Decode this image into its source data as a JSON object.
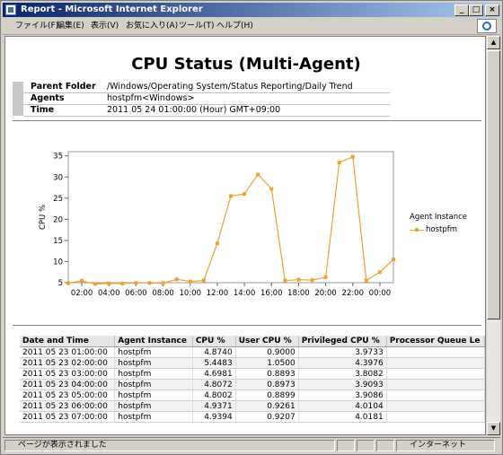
{
  "window": {
    "title": "Report - Microsoft Internet Explorer",
    "status_text": "ページが表示されました",
    "zone_text": "インターネット"
  },
  "menu": [
    "ファイル(F)",
    "編集(E)",
    "表示(V)",
    "お気に入り(A)",
    "ツール(T)",
    "ヘルプ(H)"
  ],
  "report": {
    "title": "CPU Status (Multi-Agent)",
    "info": [
      {
        "key": "Parent Folder",
        "value": "/Windows/Operating System/Status Reporting/Daily Trend"
      },
      {
        "key": "Agents",
        "value": "hostpfm<Windows>"
      },
      {
        "key": "Time",
        "value": "2011 05 24 01:00:00  (Hour)  GMT+09:00"
      }
    ]
  },
  "chart_data": {
    "type": "line",
    "ylabel": "CPU %",
    "xlabel": "",
    "ylim": [
      5,
      36
    ],
    "yticks": [
      5,
      10,
      15,
      20,
      25,
      30,
      35
    ],
    "xtick_labels": [
      "02:00",
      "04:00",
      "06:00",
      "08:00",
      "10:00",
      "12:00",
      "14:00",
      "16:00",
      "18:00",
      "20:00",
      "22:00",
      "00:00"
    ],
    "legend_title": "Agent Instance",
    "color": "#f0a030",
    "series": [
      {
        "name": "hostpfm",
        "x": [
          "01:00",
          "02:00",
          "03:00",
          "04:00",
          "05:00",
          "06:00",
          "07:00",
          "08:00",
          "09:00",
          "10:00",
          "11:00",
          "12:00",
          "13:00",
          "14:00",
          "15:00",
          "16:00",
          "17:00",
          "18:00",
          "19:00",
          "20:00",
          "21:00",
          "22:00",
          "23:00",
          "00:00",
          "01:00"
        ],
        "values": [
          4.874,
          5.448,
          4.698,
          4.807,
          4.8,
          4.937,
          4.939,
          4.9,
          5.8,
          5.3,
          5.5,
          14.3,
          25.5,
          26.0,
          30.6,
          27.2,
          5.5,
          5.7,
          5.6,
          6.3,
          33.4,
          34.8,
          5.5,
          7.5,
          10.5
        ]
      }
    ]
  },
  "table": {
    "columns": [
      "Date and Time",
      "Agent Instance",
      "CPU %",
      "User CPU %",
      "Privileged CPU %",
      "Processor Queue Le"
    ],
    "rows": [
      [
        "2011 05 23 01:00:00",
        "hostpfm",
        "4.8740",
        "0.9000",
        "3.9733",
        ""
      ],
      [
        "2011 05 23 02:00:00",
        "hostpfm",
        "5.4483",
        "1.0500",
        "4.3976",
        ""
      ],
      [
        "2011 05 23 03:00:00",
        "hostpfm",
        "4.6981",
        "0.8893",
        "3.8082",
        ""
      ],
      [
        "2011 05 23 04:00:00",
        "hostpfm",
        "4.8072",
        "0.8973",
        "3.9093",
        ""
      ],
      [
        "2011 05 23 05:00:00",
        "hostpfm",
        "4.8002",
        "0.8899",
        "3.9086",
        ""
      ],
      [
        "2011 05 23 06:00:00",
        "hostpfm",
        "4.9371",
        "0.9261",
        "4.0104",
        ""
      ],
      [
        "2011 05 23 07:00:00",
        "hostpfm",
        "4.9394",
        "0.9207",
        "4.0181",
        ""
      ]
    ]
  }
}
